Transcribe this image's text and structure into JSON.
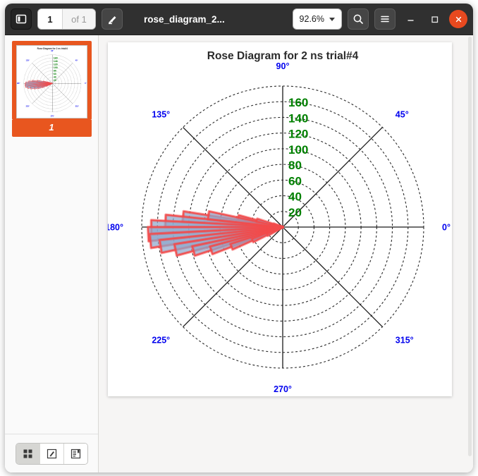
{
  "window": {
    "title": "rose_diagram_2...",
    "controls": {
      "minimize": "–",
      "maximize": "□",
      "close": "✕"
    }
  },
  "toolbar": {
    "sidebar_toggle_icon": "sidebar-icon",
    "page_current": "1",
    "page_total": "of 1",
    "annotate_icon": "pencil-highlight-icon",
    "zoom_level": "92.6%",
    "search_icon": "search-icon",
    "menu_icon": "hamburger-menu-icon"
  },
  "sidebar": {
    "thumbnail_page_label": "1",
    "modes": [
      {
        "name": "thumbnails",
        "icon": "grid-icon",
        "active": true
      },
      {
        "name": "annotations",
        "icon": "pencil-icon",
        "active": false
      },
      {
        "name": "outline",
        "icon": "bookmark-icon",
        "active": false
      }
    ]
  },
  "chart_data": {
    "type": "rose",
    "title": "Rose Diagram for 2 ns trial#4",
    "angular_labels": [
      "0°",
      "45°",
      "90°",
      "135°",
      "180°",
      "225°",
      "270°",
      "315°"
    ],
    "angular_label_angles": [
      0,
      45,
      90,
      135,
      180,
      225,
      270,
      315
    ],
    "radial_ticks": [
      20,
      40,
      60,
      80,
      100,
      120,
      140,
      160
    ],
    "radial_tick_labels": [
      "20",
      "40",
      "60",
      "80",
      "100",
      "120",
      "140",
      "160"
    ],
    "rlim": [
      0,
      180
    ],
    "grid": true,
    "theta_direction": "counterclockwise",
    "theta_zero_location": "E",
    "bin_width_deg": 6,
    "bar_fill_color": "#8fa8cc",
    "bar_edge_color": "#f24a4a",
    "radial_label_color": "#008000",
    "angular_label_color": "#0000ee",
    "bins": [
      {
        "theta": 162,
        "r": 12
      },
      {
        "theta": 168,
        "r": 58
      },
      {
        "theta": 174,
        "r": 128
      },
      {
        "theta": 177,
        "r": 150
      },
      {
        "theta": 180,
        "r": 168
      },
      {
        "theta": 183,
        "r": 172
      },
      {
        "theta": 186,
        "r": 170
      },
      {
        "theta": 189,
        "r": 158
      },
      {
        "theta": 192,
        "r": 140
      },
      {
        "theta": 195,
        "r": 118
      },
      {
        "theta": 198,
        "r": 96
      },
      {
        "theta": 201,
        "r": 70
      },
      {
        "theta": 204,
        "r": 42
      },
      {
        "theta": 207,
        "r": 22
      },
      {
        "theta": 171,
        "r": 96
      },
      {
        "theta": 165,
        "r": 34
      }
    ]
  }
}
